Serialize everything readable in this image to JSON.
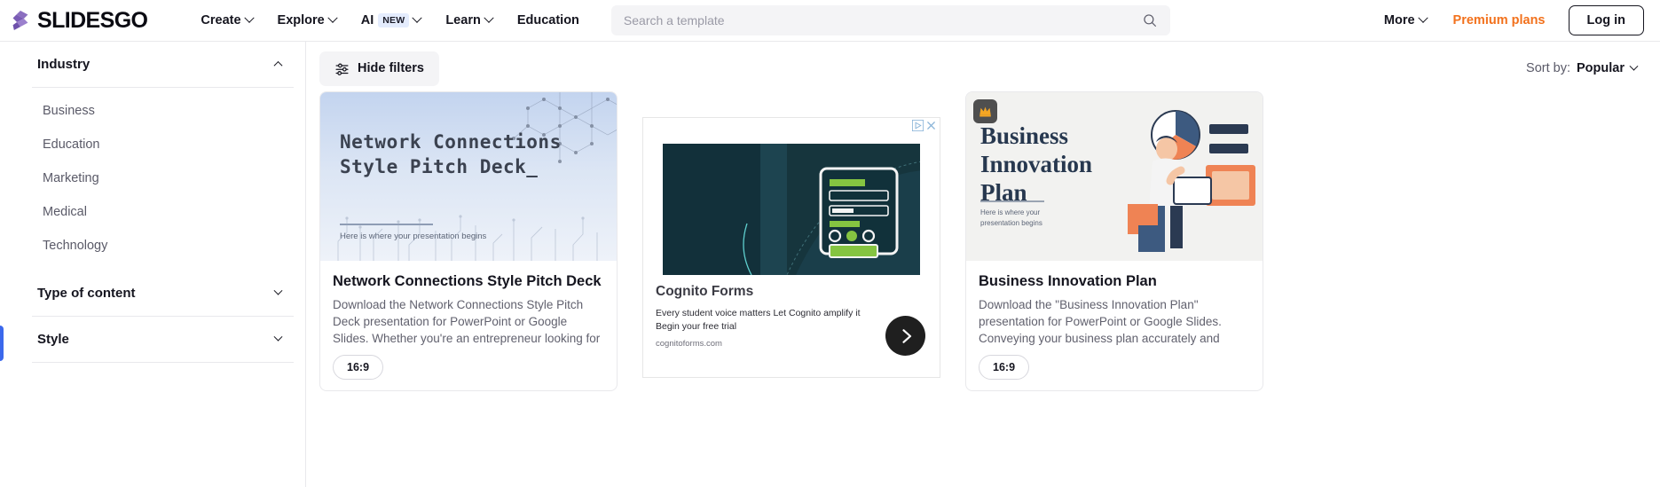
{
  "header": {
    "logo_text": "SLIDESGO",
    "nav": [
      {
        "label": "Create",
        "has_chevron": true,
        "badge": null
      },
      {
        "label": "Explore",
        "has_chevron": true,
        "badge": null
      },
      {
        "label": "AI",
        "has_chevron": true,
        "badge": "NEW"
      },
      {
        "label": "Learn",
        "has_chevron": true,
        "badge": null
      },
      {
        "label": "Education",
        "has_chevron": false,
        "badge": null
      }
    ],
    "search": {
      "placeholder": "Search a template",
      "value": "",
      "icon": "search-icon"
    },
    "more_label": "More",
    "premium_label": "Premium plans",
    "login_label": "Log in",
    "premium_color": "#f2711c"
  },
  "sidebar": {
    "groups": [
      {
        "title": "Industry",
        "expanded": true,
        "chevron": "chevron-up-icon",
        "options": [
          "Business",
          "Education",
          "Marketing",
          "Medical",
          "Technology"
        ]
      },
      {
        "title": "Type of content",
        "expanded": false,
        "chevron": "chevron-down-icon",
        "options": []
      },
      {
        "title": "Style",
        "expanded": false,
        "chevron": "chevron-down-icon",
        "options": []
      }
    ]
  },
  "toolbar": {
    "hide_filters_label": "Hide filters",
    "hide_filters_icon": "sliders-icon",
    "sort_label": "Sort by:",
    "sort_value": "Popular"
  },
  "cards": [
    {
      "type": "template",
      "thumb_title": "Network Connections Style Pitch Deck_",
      "thumb_subtitle": "Here is where your presentation begins",
      "title": "Network Connections Style Pitch Deck",
      "description": "Download the Network Connections Style Pitch Deck presentation for PowerPoint or Google Slides. Whether you're an entrepreneur looking for funding or a sales...",
      "ratio": "16:9",
      "premium": false
    },
    {
      "type": "ad",
      "ad_title": "Cognito Forms",
      "ad_body": "Every student voice matters Let Cognito amplify it Begin your free trial",
      "ad_url": "cognitoforms.com",
      "arrow_icon": "chevron-right-icon",
      "close_icon": "close-icon",
      "adchoices_icon": "adchoices-icon"
    },
    {
      "type": "template",
      "thumb_title": "Business Innovation Plan",
      "thumb_subtitle": "Here is where your presentation begins",
      "title": "Business Innovation Plan",
      "description": "Download the \"Business Innovation Plan\" presentation for PowerPoint or Google Slides. Conveying your business plan accurately and effectively is the...",
      "ratio": "16:9",
      "premium": true,
      "premium_icon": "crown-icon"
    }
  ]
}
